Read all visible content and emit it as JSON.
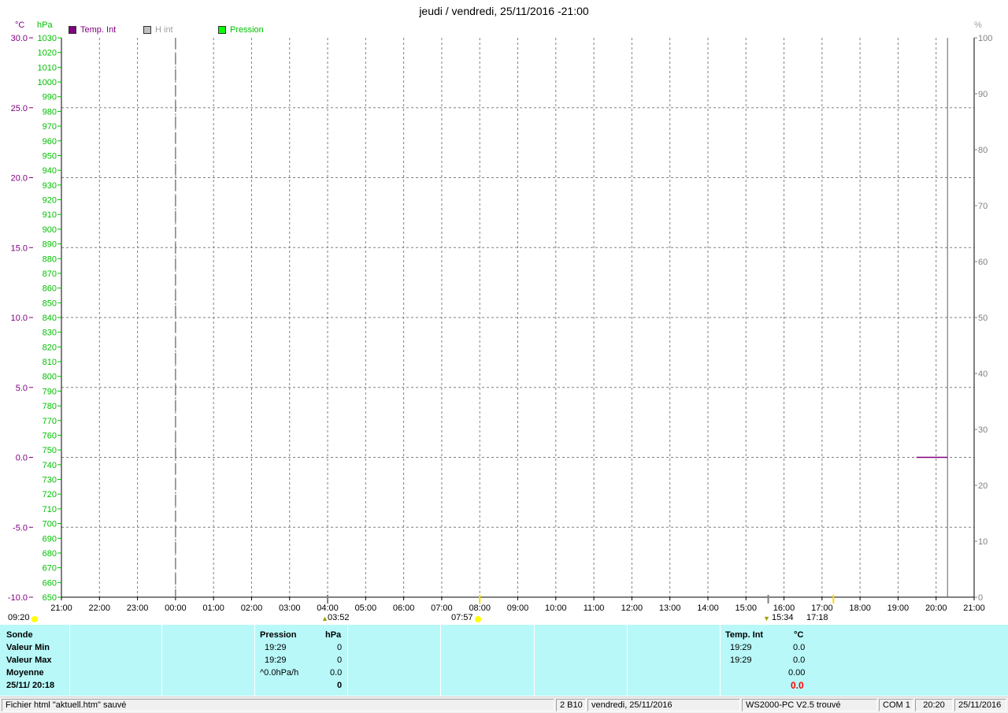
{
  "window": {
    "title": "jeudi / vendredi, 25/11/2016  -21:00"
  },
  "legend": [
    {
      "label": "Temp. Int",
      "color": "#800080",
      "swatch": "#800080",
      "text_color": "#800080"
    },
    {
      "label": "H int",
      "color": "#c0c0c0",
      "swatch": "#c0c0c0",
      "text_color": "#a0a0a0"
    },
    {
      "label": "Pression",
      "color": "#00c000",
      "swatch": "#00ff00",
      "text_color": "#00c000"
    }
  ],
  "units": {
    "temp": "°C",
    "pressure": "hPa",
    "humidity": "%"
  },
  "chart_data": {
    "type": "line",
    "x": [
      "21:00",
      "22:00",
      "23:00",
      "00:00",
      "01:00",
      "02:00",
      "03:00",
      "04:00",
      "05:00",
      "06:00",
      "07:00",
      "08:00",
      "09:00",
      "10:00",
      "11:00",
      "12:00",
      "13:00",
      "14:00",
      "15:00",
      "16:00",
      "17:00",
      "18:00",
      "19:00",
      "20:00",
      "21:00"
    ],
    "temp_axis": {
      "ticks": [
        "30.0",
        "25.0",
        "20.0",
        "15.0",
        "10.0",
        "5.0",
        "0.0",
        "-5.0",
        "-10.0"
      ],
      "ylim": [
        -10,
        30
      ],
      "color": "#800080"
    },
    "pressure_axis": {
      "ylim": [
        650,
        1030
      ],
      "step": 10,
      "color": "#00c000"
    },
    "humidity_axis": {
      "ticks": [
        "100",
        "90",
        "80",
        "70",
        "60",
        "50",
        "40",
        "30",
        "20",
        "10",
        "0"
      ],
      "ylim": [
        0,
        100
      ],
      "color": "#808080"
    },
    "grid": true,
    "midnight_marker": "00:00",
    "current_time_marker": "20:18",
    "series": [
      {
        "name": "Temp. Int",
        "color": "#800080",
        "x_start": "19:29",
        "x_end": "20:18",
        "values": [
          0.0,
          0.0
        ]
      }
    ],
    "sun_events": [
      {
        "label": "09:20",
        "kind": "sunset"
      },
      {
        "label": "03:52",
        "kind": "sunrise"
      },
      {
        "label": "07:57",
        "kind": "moon"
      },
      {
        "label": "15:34",
        "kind": "sunset"
      },
      {
        "label": "17:18",
        "kind": "moonset"
      }
    ]
  },
  "stats": {
    "labels": {
      "sonde": "Sonde",
      "min": "Valeur Min",
      "max": "Valeur Max",
      "moyenne": "Moyenne",
      "datetime": "25/11/ 20:18"
    },
    "pression": {
      "title": "Pression",
      "unit": "hPa",
      "min_time": "19:29",
      "min_val": "0",
      "max_time": "19:29",
      "max_val": "0",
      "trend": "^0.0hPa/h",
      "avg": "0.0",
      "current": "0"
    },
    "temp_int": {
      "title": "Temp. Int",
      "unit": "°C",
      "min_time": "19:29",
      "min_val": "0.0",
      "max_time": "19:29",
      "max_val": "0.0",
      "avg": "0.00",
      "current": "0.0"
    }
  },
  "statusbar": {
    "file": "Fichier html  \"aktuell.htm\"  sauvé",
    "code": "2 B10",
    "date": "vendredi, 25/11/2016",
    "device": "WS2000-PC V2.5 trouvé",
    "port": "COM 1",
    "time": "20:20",
    "date2": "25/11/2016"
  }
}
